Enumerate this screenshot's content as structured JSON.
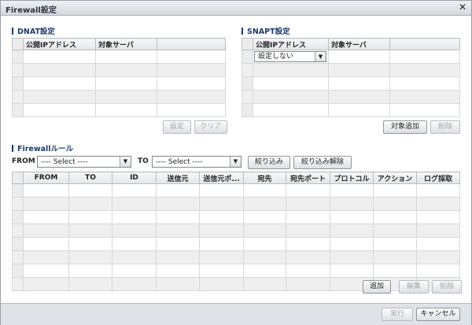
{
  "dialog": {
    "title": "Firewall設定",
    "close_glyph": "✕"
  },
  "dnat": {
    "title": "DNAT設定",
    "columns": [
      "公開IPアドレス",
      "対象サーバ"
    ],
    "buttons": {
      "setting": "設定",
      "clear": "クリア"
    }
  },
  "snapt": {
    "title": "SNAPT設定",
    "columns": [
      "公開IPアドレス",
      "対象サーバ"
    ],
    "row_select_value": "設定しない",
    "buttons": {
      "add_target": "対象追加",
      "delete": "削除"
    }
  },
  "firewall": {
    "title": "Firewallルール",
    "from_label": "FROM",
    "to_label": "TO",
    "from_select": "---- Select ----",
    "to_select": "---- Select ----",
    "filter_button": "絞り込み",
    "clear_filter_button": "絞り込み解除",
    "columns": [
      "FROM",
      "TO",
      "ID",
      "送信元",
      "送信元ポ...",
      "宛先",
      "宛先ポート",
      "プロトコル",
      "アクション",
      "ログ採取"
    ],
    "buttons": {
      "add": "追加",
      "edit": "編集",
      "delete": "削除"
    }
  },
  "footer": {
    "execute": "実行",
    "cancel": "キャンセル"
  }
}
